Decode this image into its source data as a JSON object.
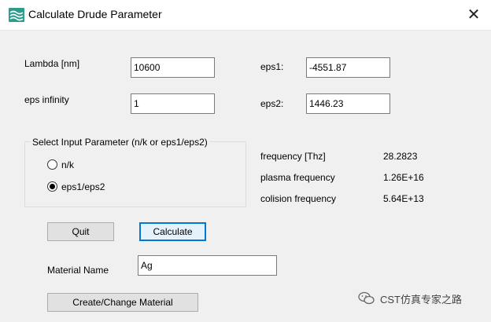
{
  "window": {
    "title": "Calculate Drude Parameter",
    "close_glyph": "✕",
    "icon": "app-icon"
  },
  "inputs": {
    "lambda_label": "Lambda  [nm]",
    "lambda_value": "10600",
    "eps_infinity_label": "eps infinity",
    "eps_infinity_value": "1",
    "eps1_label": "eps1:",
    "eps1_value": "-4551.87",
    "eps2_label": "eps2:",
    "eps2_value": "1446.23"
  },
  "selection": {
    "caption": "Select Input Parameter (n/k or eps1/eps2)",
    "options": [
      {
        "label": "n/k",
        "selected": false
      },
      {
        "label": "eps1/eps2",
        "selected": true
      }
    ]
  },
  "results": [
    {
      "label": "frequency [Thz]",
      "value": "28.2823"
    },
    {
      "label": "plasma frequency",
      "value": "1.26E+16"
    },
    {
      "label": "colision frequency",
      "value": "5.64E+13"
    }
  ],
  "buttons": {
    "quit": "Quit",
    "calculate": "Calculate",
    "create_change": "Create/Change Material"
  },
  "material": {
    "label": "Material Name",
    "value": "Ag"
  },
  "watermark": {
    "text": "CST仿真专家之路"
  },
  "colors": {
    "accent": "#0078d7",
    "app_icon": "#2c9c8c"
  }
}
